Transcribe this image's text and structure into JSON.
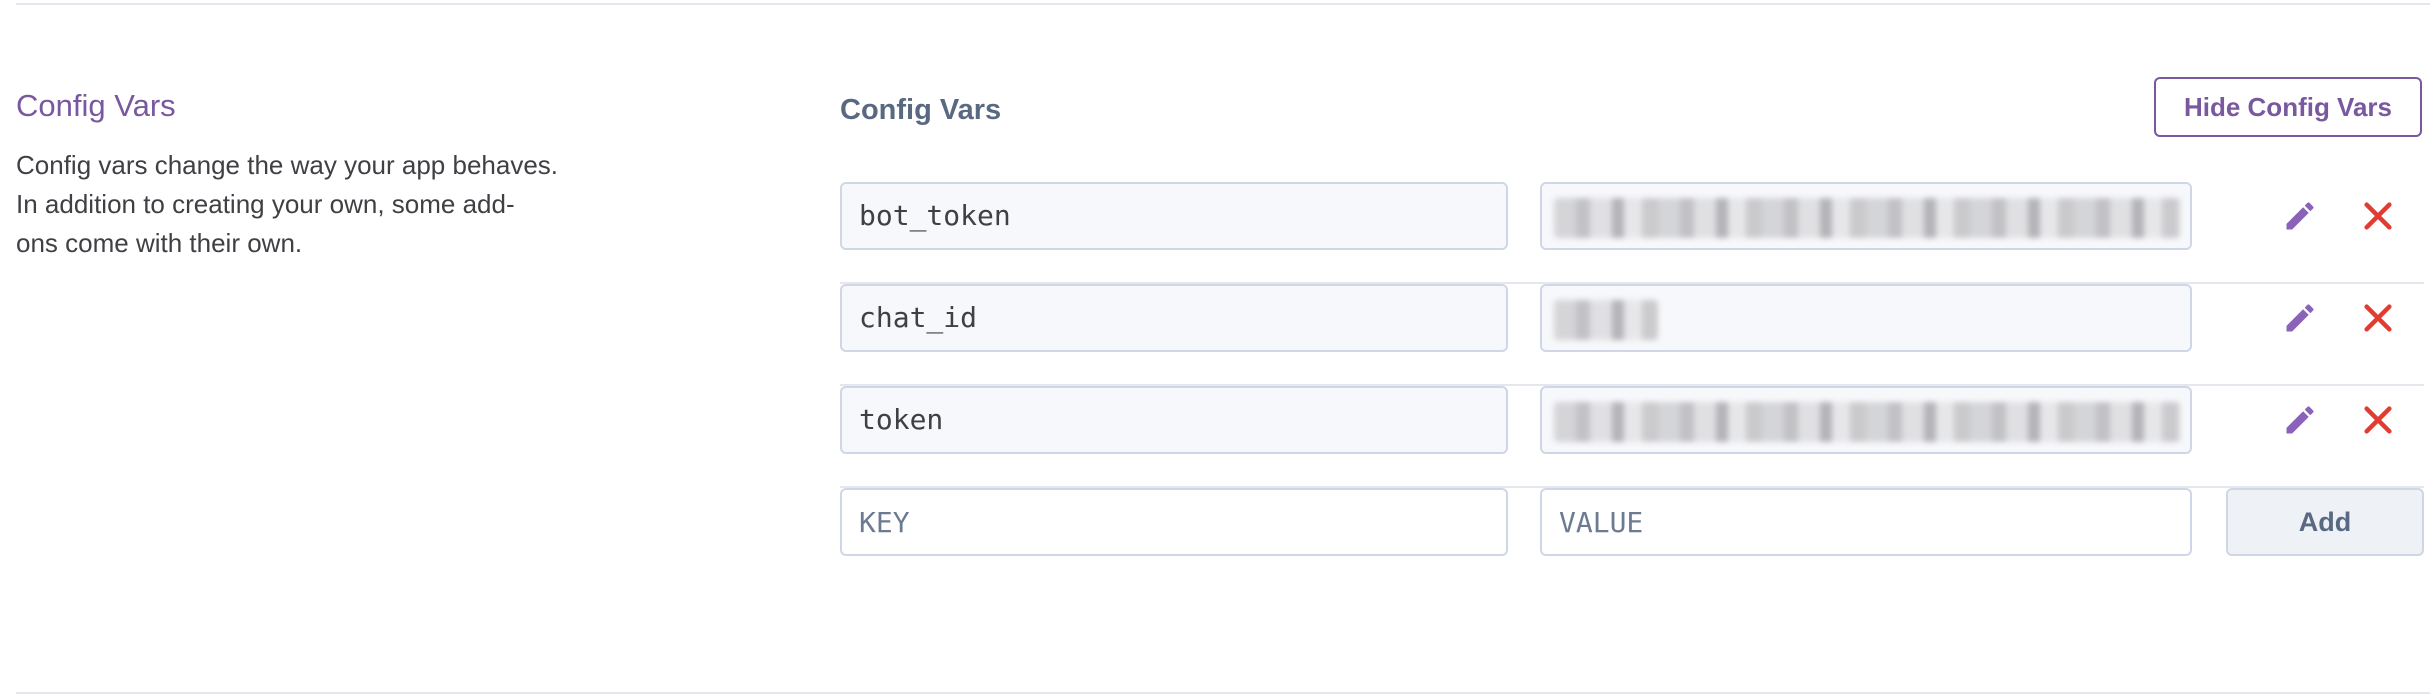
{
  "section": {
    "title": "Config Vars",
    "description_lines": [
      "Config vars change the way your app behaves.",
      "In addition to creating your own, some add-",
      "ons come with their own."
    ]
  },
  "panel": {
    "title": "Config Vars",
    "hide_button_label": "Hide Config Vars",
    "vars": [
      {
        "key": "bot_token",
        "value_visible": false
      },
      {
        "key": "chat_id",
        "value_visible": false
      },
      {
        "key": "token",
        "value_visible": false
      }
    ],
    "new_var": {
      "key_placeholder": "KEY",
      "value_placeholder": "VALUE",
      "add_button_label": "Add"
    }
  },
  "icons": {
    "edit": "pencil-icon",
    "delete": "close-icon"
  },
  "colors": {
    "accent": "#79589f",
    "delete": "#e03c31",
    "muted_text": "#596981",
    "border": "#cfd7e6"
  }
}
